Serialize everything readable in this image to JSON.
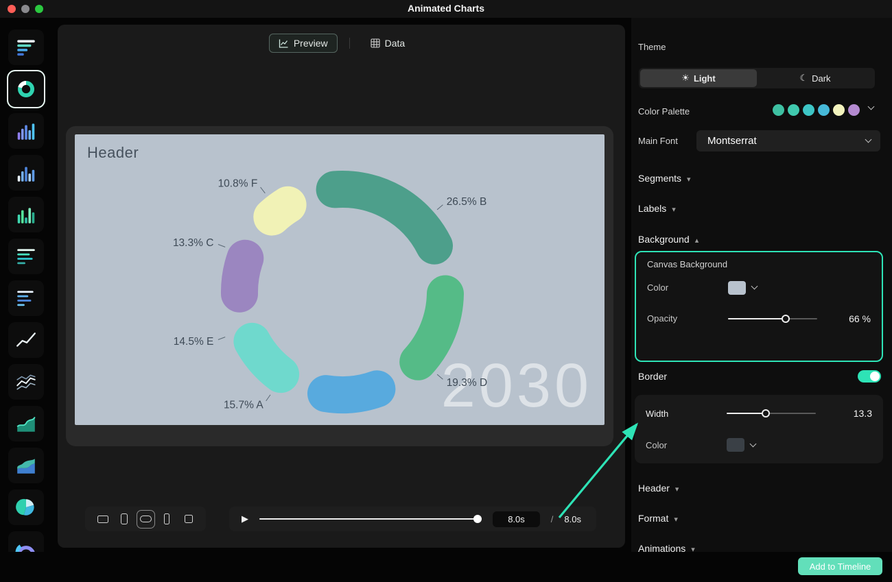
{
  "window": {
    "title": "Animated Charts"
  },
  "colors": {
    "accent": "#2ee3b6"
  },
  "sidebar": {
    "items": [
      {
        "name": "bars-horizontal",
        "selected": false
      },
      {
        "name": "donut",
        "selected": true
      },
      {
        "name": "columns-purple",
        "selected": false
      },
      {
        "name": "columns-blue",
        "selected": false
      },
      {
        "name": "columns-teal",
        "selected": false
      },
      {
        "name": "bars-thin-teal",
        "selected": false
      },
      {
        "name": "bars-thin-blue",
        "selected": false
      },
      {
        "name": "line",
        "selected": false
      },
      {
        "name": "lines-multi",
        "selected": false
      },
      {
        "name": "area",
        "selected": false
      },
      {
        "name": "area-stacked",
        "selected": false
      },
      {
        "name": "pie",
        "selected": false
      },
      {
        "name": "donut-partial",
        "selected": false
      }
    ]
  },
  "tabs": {
    "preview": "Preview",
    "data": "Data"
  },
  "chart_data": {
    "type": "donut",
    "header": "Header",
    "watermark": "2030",
    "canvas_color": "#b8c2cd",
    "values_are_percent": true,
    "start_angle_deg": -57,
    "gap_deg": 7,
    "legend": "none",
    "segments": [
      {
        "label": "F",
        "value": 10.8,
        "display": "10.8% F",
        "color": "#f1f2b6",
        "label_angle": -38
      },
      {
        "label": "B",
        "value": 26.5,
        "display": "26.5% B",
        "color": "#4d9f8b",
        "label_angle": 49
      },
      {
        "label": "D",
        "value": 19.3,
        "display": "19.3% D",
        "color": "#55bb87",
        "label_angle": 131
      },
      {
        "label": "A",
        "value": 15.7,
        "display": "15.7% A",
        "color": "#58aade",
        "label_angle": 215
      },
      {
        "label": "E",
        "value": 14.5,
        "display": "14.5% E",
        "color": "#6fd9cd",
        "label_angle": 249
      },
      {
        "label": "C",
        "value": 13.3,
        "display": "13.3% C",
        "color": "#9b86c0",
        "label_angle": 291
      }
    ]
  },
  "viewport_selector": {
    "options": [
      "landscape",
      "phone-portrait",
      "rounded-landscape",
      "phone-narrow",
      "square"
    ],
    "selected": "rounded-landscape"
  },
  "player": {
    "current_time": "8.0s",
    "divider": "/",
    "total_time": "8.0s",
    "progress_percent": 100
  },
  "panel": {
    "theme": {
      "label": "Theme",
      "light_label": "Light",
      "dark_label": "Dark",
      "selected": "Light"
    },
    "color_palette": {
      "label": "Color Palette",
      "swatches": [
        "#3ec0a2",
        "#40c9ae",
        "#3dc5c5",
        "#46b9d8",
        "#f3f3bd",
        "#b48ad0"
      ]
    },
    "main_font": {
      "label": "Main Font",
      "value": "Montserrat"
    },
    "sections": {
      "segments": "Segments",
      "labels": "Labels",
      "background": "Background",
      "header": "Header",
      "format": "Format",
      "animations": "Animations"
    },
    "canvas_background": {
      "title": "Canvas Background",
      "color_label": "Color",
      "color_value": "#b8c2cd",
      "opacity_label": "Opacity",
      "opacity_display": "66 %",
      "opacity_percent": 66
    },
    "border": {
      "label": "Border",
      "enabled": true,
      "width_label": "Width",
      "width_display": "13.3",
      "width_percent": 43,
      "color_label": "Color",
      "color_value": "#3a4046"
    },
    "add_to_timeline": "Add to Timeline"
  }
}
